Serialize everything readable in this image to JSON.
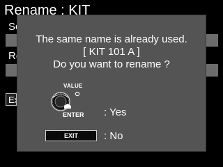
{
  "screen": {
    "title": "Rename : KIT"
  },
  "background": {
    "label_1": "Sc",
    "label_2": "Re",
    "exit_partial": "Ex"
  },
  "dialog": {
    "line_1": "The same name is already used.",
    "line_2": "[ KIT 101 A ]",
    "line_3": "Do you want to rename ?",
    "value_label": "VALUE",
    "enter_label": "ENTER",
    "yes_label": ": Yes",
    "exit_button_label": "EXIT",
    "no_label": ": No"
  }
}
